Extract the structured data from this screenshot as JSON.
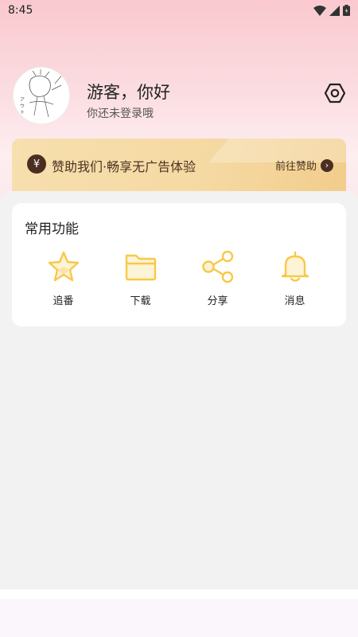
{
  "status": {
    "time": "8:45"
  },
  "profile": {
    "greeting": "游客，你好",
    "subtext": "你还未登录哦"
  },
  "sponsor": {
    "currency_symbol": "¥",
    "text": "赞助我们·畅享无广告体验",
    "link_label": "前往赞助"
  },
  "functions": {
    "title": "常用功能",
    "items": [
      {
        "label": "追番",
        "icon": "star-icon"
      },
      {
        "label": "下载",
        "icon": "folder-icon"
      },
      {
        "label": "分享",
        "icon": "share-icon"
      },
      {
        "label": "消息",
        "icon": "bell-icon"
      }
    ]
  },
  "colors": {
    "accent": "#f7c948",
    "header_pink": "#f9c9cf",
    "sponsor_gold": "#f5d9a2",
    "sponsor_dark": "#4a2f20"
  }
}
